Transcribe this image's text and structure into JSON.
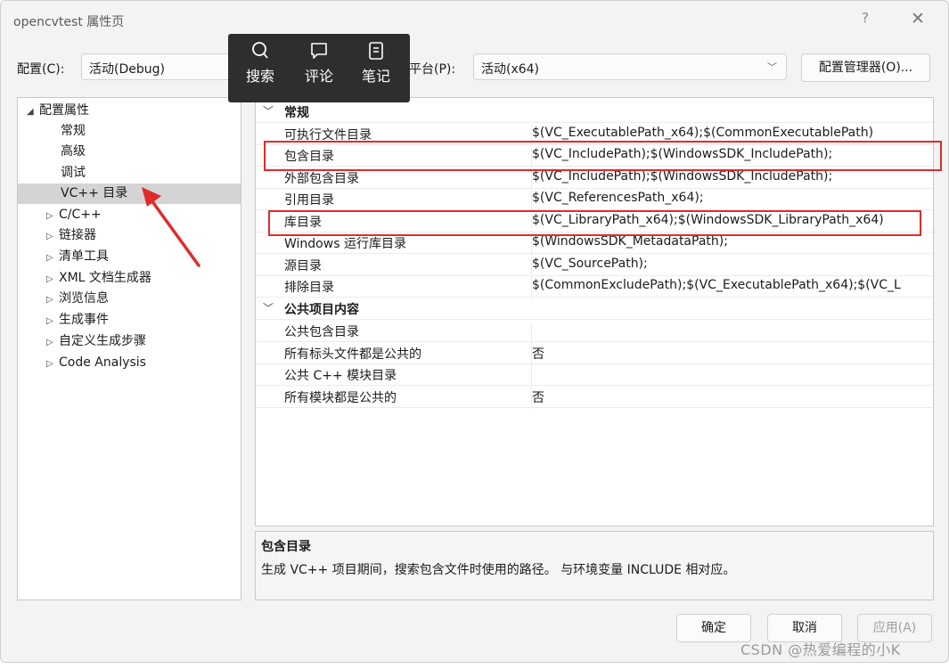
{
  "window": {
    "title": "opencvtest 属性页",
    "help": "?",
    "close": "✕"
  },
  "top": {
    "config_label": "配置(C):",
    "config_value": "活动(Debug)",
    "platform_label": "平台(P):",
    "platform_value": "活动(x64)",
    "config_manager": "配置管理器(O)..."
  },
  "popup": [
    {
      "label": "搜索",
      "icon": "search-icon"
    },
    {
      "label": "评论",
      "icon": "comment-icon"
    },
    {
      "label": "笔记",
      "icon": "note-icon"
    }
  ],
  "tree": {
    "root": "配置属性",
    "children": [
      "常规",
      "高级",
      "调试",
      "VC++ 目录"
    ],
    "groups": [
      "C/C++",
      "链接器",
      "清单工具",
      "XML 文档生成器",
      "浏览信息",
      "生成事件",
      "自定义生成步骤",
      "Code Analysis"
    ]
  },
  "grid": {
    "cat1": "常规",
    "rows1": [
      {
        "name": "可执行文件目录",
        "value": "$(VC_ExecutablePath_x64);$(CommonExecutablePath)"
      },
      {
        "name": "包含目录",
        "value": "$(VC_IncludePath);$(WindowsSDK_IncludePath);"
      },
      {
        "name": "外部包含目录",
        "value": "$(VC_IncludePath);$(WindowsSDK_IncludePath);"
      },
      {
        "name": "引用目录",
        "value": "$(VC_ReferencesPath_x64);"
      },
      {
        "name": "库目录",
        "value": "$(VC_LibraryPath_x64);$(WindowsSDK_LibraryPath_x64)"
      },
      {
        "name": "Windows 运行库目录",
        "value": "$(WindowsSDK_MetadataPath);"
      },
      {
        "name": "源目录",
        "value": "$(VC_SourcePath);"
      },
      {
        "name": "排除目录",
        "value": "$(CommonExcludePath);$(VC_ExecutablePath_x64);$(VC_L"
      }
    ],
    "cat2": "公共项目内容",
    "rows2": [
      {
        "name": "公共包含目录",
        "value": ""
      },
      {
        "name": "所有标头文件都是公共的",
        "value": "否"
      },
      {
        "name": "公共 C++ 模块目录",
        "value": ""
      },
      {
        "name": "所有模块都是公共的",
        "value": "否"
      }
    ]
  },
  "description": {
    "title": "包含目录",
    "text": "生成 VC++ 项目期间，搜索包含文件时使用的路径。 与环境变量 INCLUDE 相对应。"
  },
  "buttons": {
    "ok": "确定",
    "cancel": "取消",
    "apply": "应用(A)"
  },
  "watermark": "CSDN @热爱编程的小K",
  "colors": {
    "highlight": "#e02b2b",
    "popup_bg": "#2e2e2e",
    "selected": "#d4d4d4"
  }
}
